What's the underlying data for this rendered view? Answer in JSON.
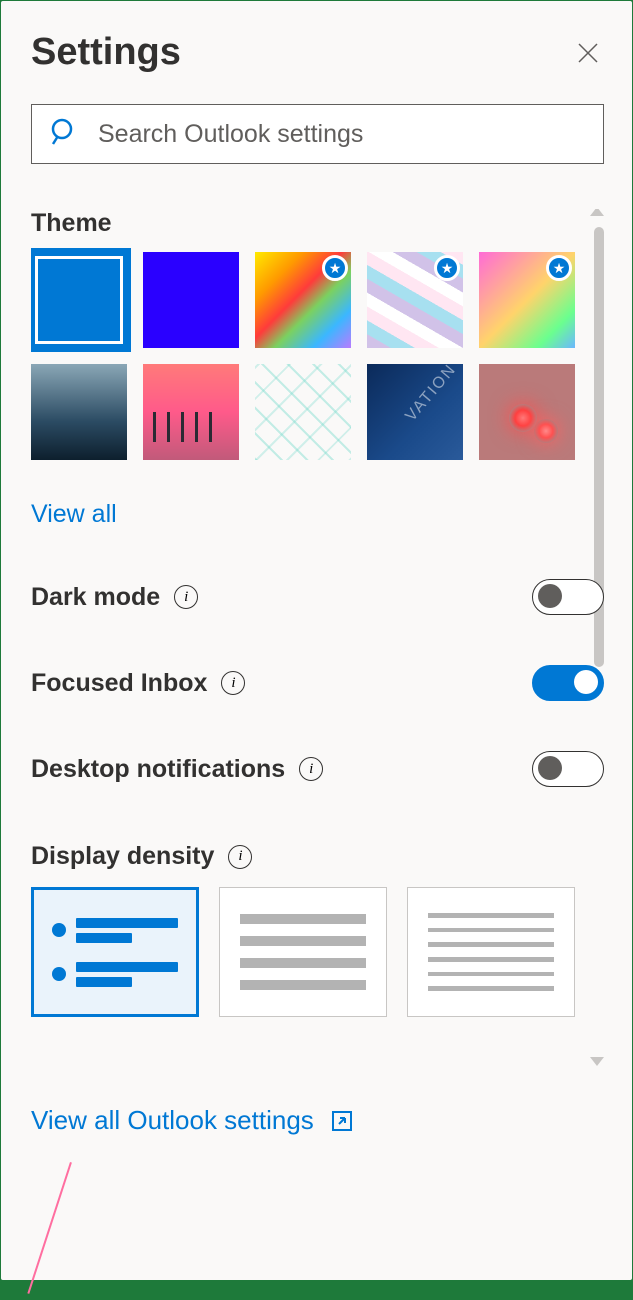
{
  "header": {
    "title": "Settings"
  },
  "search": {
    "placeholder": "Search Outlook settings"
  },
  "theme": {
    "label": "Theme",
    "view_all": "View all",
    "tiles": [
      {
        "name": "blue-default",
        "selected": true,
        "premium": false
      },
      {
        "name": "bright-blue",
        "selected": false,
        "premium": false
      },
      {
        "name": "rainbow-wave",
        "selected": false,
        "premium": true
      },
      {
        "name": "pastel-ribbons",
        "selected": false,
        "premium": true
      },
      {
        "name": "unicorn-art",
        "selected": false,
        "premium": true
      },
      {
        "name": "ocean-wave",
        "selected": false,
        "premium": false
      },
      {
        "name": "sunset-palms",
        "selected": false,
        "premium": false
      },
      {
        "name": "circuit-board",
        "selected": false,
        "premium": false
      },
      {
        "name": "innovation-blueprint",
        "selected": false,
        "premium": false
      },
      {
        "name": "red-bokeh",
        "selected": false,
        "premium": false
      }
    ]
  },
  "toggles": {
    "dark_mode": {
      "label": "Dark mode",
      "on": false
    },
    "focused_inbox": {
      "label": "Focused Inbox",
      "on": true
    },
    "desktop_notifications": {
      "label": "Desktop notifications",
      "on": false
    }
  },
  "density": {
    "label": "Display density",
    "options": [
      "full",
      "medium",
      "compact"
    ],
    "selected": "full"
  },
  "footer": {
    "view_all": "View all Outlook settings"
  }
}
